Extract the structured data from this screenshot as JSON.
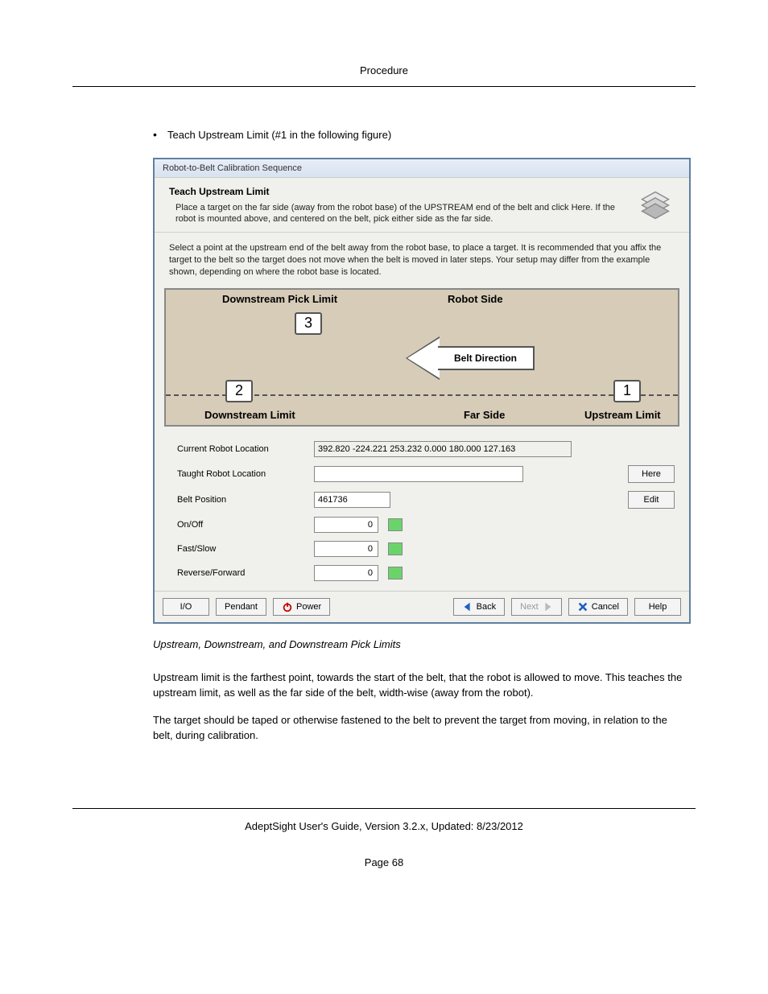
{
  "header": {
    "title": "Procedure"
  },
  "bullet": {
    "text": "Teach Upstream Limit (#1 in the following figure)"
  },
  "dialog": {
    "window_title": "Robot-to-Belt Calibration Sequence",
    "step_title": "Teach Upstream Limit",
    "step_desc": "Place a target on the far side (away from the robot base) of the UPSTREAM end of the belt and click Here.  If the robot is mounted above, and centered on the belt, pick either side as the far side.",
    "instruction": "Select a point at the upstream end of the belt away from the robot base, to place a target. It is recommended that you affix the target to the belt so the target does not move when the belt is moved in later steps. Your setup may differ from the example shown, depending on where the robot base is located.",
    "diagram": {
      "downstream_pick": "Downstream Pick Limit",
      "robot_side": "Robot Side",
      "belt_direction": "Belt Direction",
      "downstream_limit": "Downstream Limit",
      "far_side": "Far Side",
      "upstream_limit": "Upstream Limit",
      "n1": "1",
      "n2": "2",
      "n3": "3"
    },
    "fields": {
      "current_label": "Current Robot Location",
      "current_value": "392.820 -224.221 253.232 0.000 180.000 127.163",
      "taught_label": "Taught Robot Location",
      "taught_value": "",
      "here_btn": "Here",
      "belt_label": "Belt Position",
      "belt_value": "461736",
      "edit_btn": "Edit",
      "onoff_label": "On/Off",
      "onoff_value": "0",
      "fastslow_label": "Fast/Slow",
      "fastslow_value": "0",
      "revfwd_label": "Reverse/Forward",
      "revfwd_value": "0"
    },
    "footer": {
      "io": "I/O",
      "pendant": "Pendant",
      "power": "Power",
      "back": "Back",
      "next": "Next",
      "cancel": "Cancel",
      "help": "Help"
    }
  },
  "caption": "Upstream, Downstream, and Downstream Pick Limits",
  "para1": "Upstream limit is the farthest point, towards the start of the belt, that the robot is allowed to move. This teaches the upstream limit, as well as the far side of the belt, width-wise (away from the robot).",
  "para2": "The target should be taped or otherwise fastened to the belt to prevent the target from moving, in relation to the belt, during calibration.",
  "footer_line": "AdeptSight User's Guide,  Version 3.2.x,  Updated: 8/23/2012",
  "page_num": "Page 68"
}
